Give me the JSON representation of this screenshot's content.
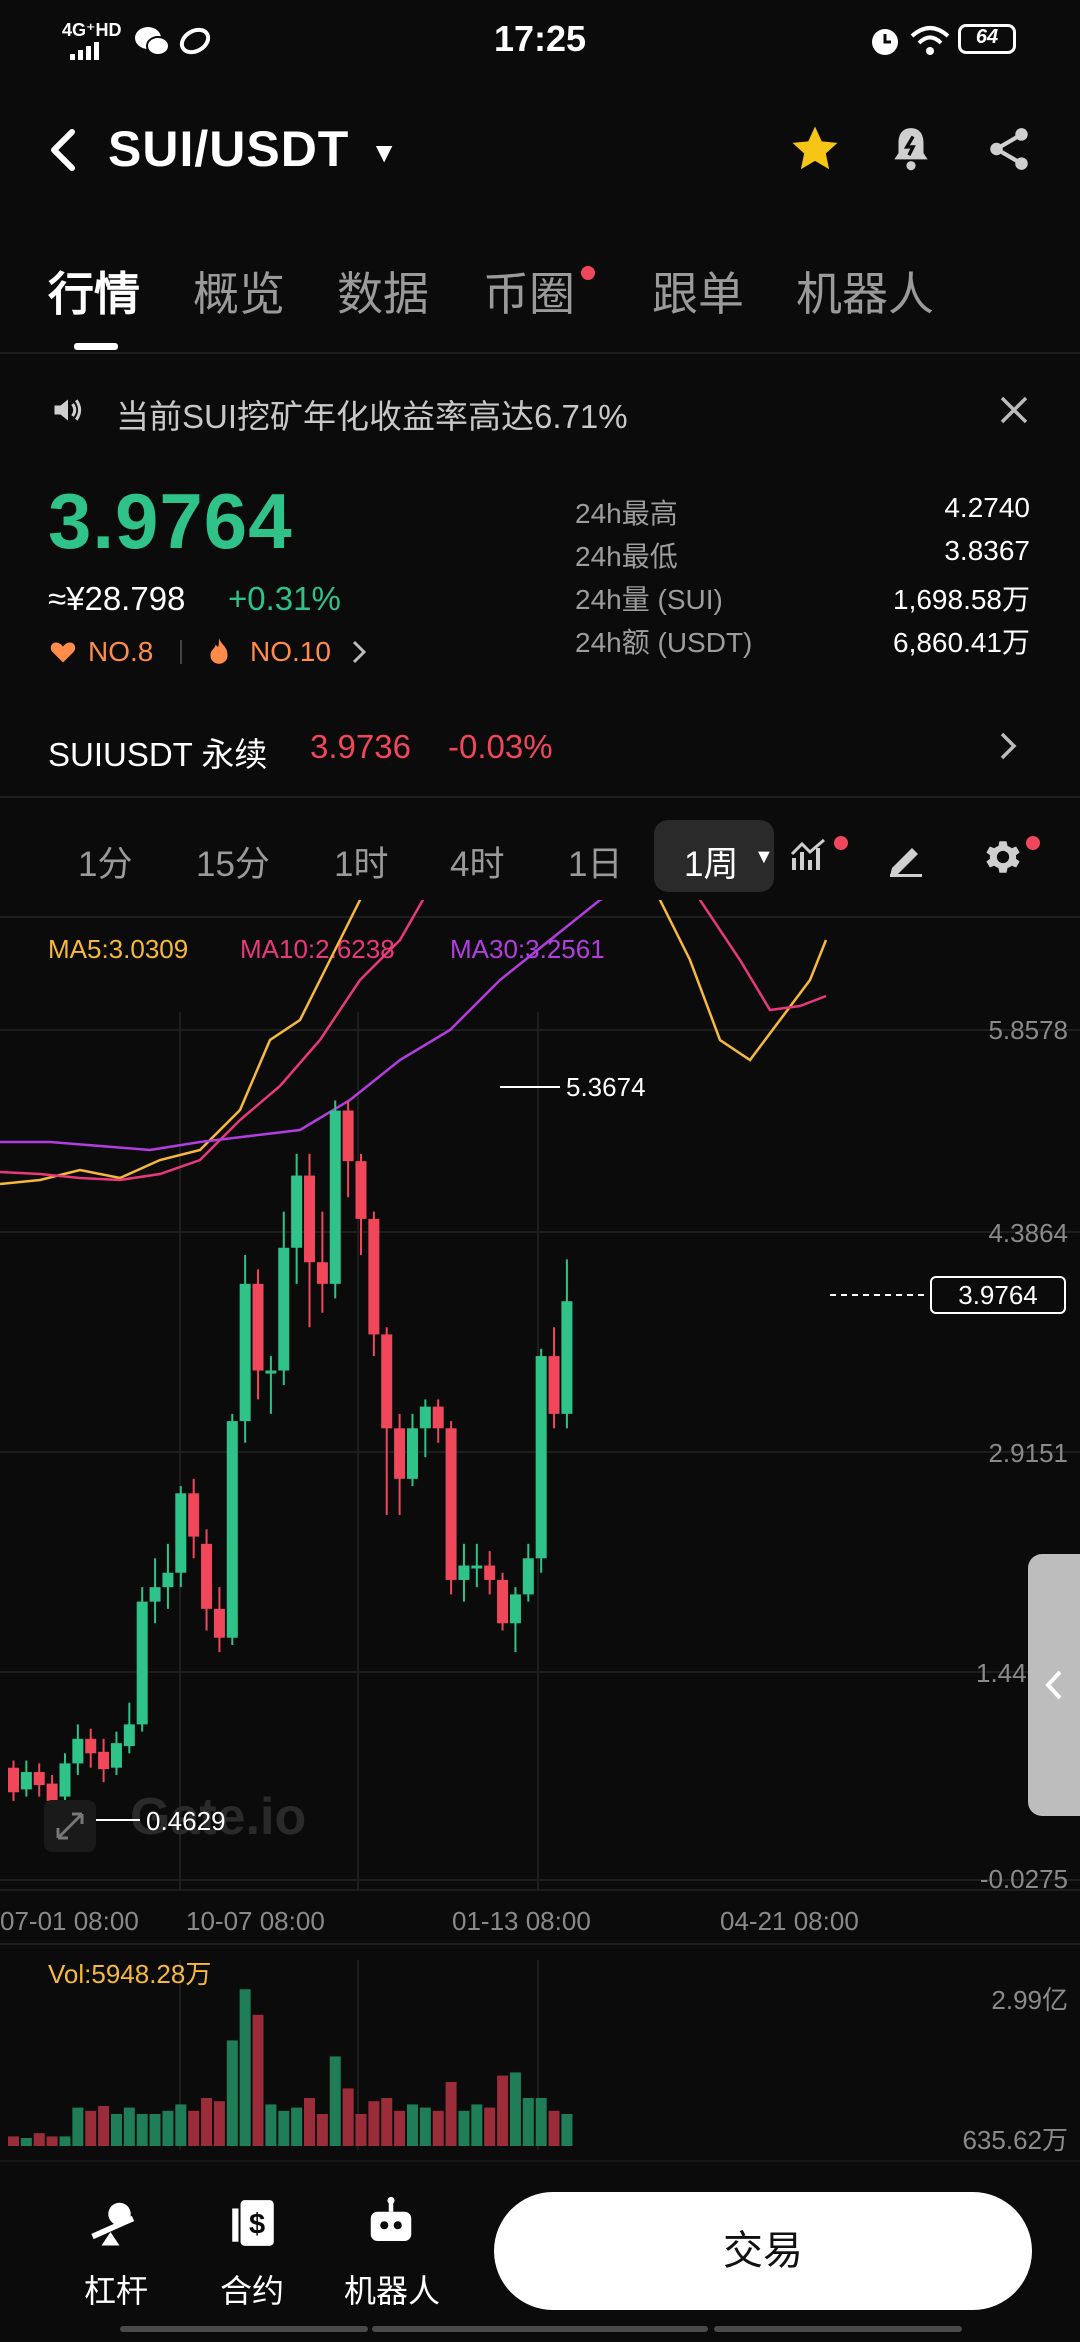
{
  "status_bar": {
    "time": "17:25",
    "network": "4G⁺HD",
    "battery": "64"
  },
  "header": {
    "pair": "SUI/USDT"
  },
  "tabs": [
    {
      "label": "行情",
      "active": true
    },
    {
      "label": "概览"
    },
    {
      "label": "数据"
    },
    {
      "label": "币圈",
      "dot": true
    },
    {
      "label": "跟单"
    },
    {
      "label": "机器人"
    }
  ],
  "notice": {
    "text": "当前SUI挖矿年化收益率高达6.71%"
  },
  "price": {
    "last": "3.9764",
    "cny": "≈¥28.798",
    "change": "+0.31%",
    "rank1": "NO.8",
    "rank2": "NO.10"
  },
  "stats": [
    {
      "label": "24h最高",
      "value": "4.2740"
    },
    {
      "label": "24h最低",
      "value": "3.8367"
    },
    {
      "label": "24h量 (SUI)",
      "value": "1,698.58万"
    },
    {
      "label": "24h额 (USDT)",
      "value": "6,860.41万"
    }
  ],
  "perp": {
    "name": "SUIUSDT 永续",
    "price": "3.9736",
    "change": "-0.03%"
  },
  "intervals": [
    "1分",
    "15分",
    "1时",
    "4时",
    "1日",
    "1周"
  ],
  "active_interval": "1周",
  "ma": {
    "ma5": "MA5:3.0309",
    "ma10": "MA10:2.6238",
    "ma30": "MA30:3.2561"
  },
  "chart": {
    "y_ticks": [
      "5.8578",
      "4.3864",
      "2.9151",
      "1.44",
      "-0.0275"
    ],
    "x_ticks": [
      "07-01 08:00",
      "10-07 08:00",
      "01-13 08:00",
      "04-21 08:00"
    ],
    "high_label": "5.3674",
    "low_label": "0.4629",
    "current_label": "3.9764",
    "watermark": "Gate.io",
    "vol_label": "Vol:5948.28万",
    "vol_ticks": [
      "2.99亿",
      "635.62万"
    ]
  },
  "colors": {
    "up": "#2fc38a",
    "down": "#f0475a",
    "ma5": "#f6b93b",
    "ma10": "#e8397a",
    "ma30": "#b23ee0"
  },
  "bottom": {
    "leverage": "杠杆",
    "contract": "合约",
    "robot": "机器人",
    "trade": "交易"
  }
}
